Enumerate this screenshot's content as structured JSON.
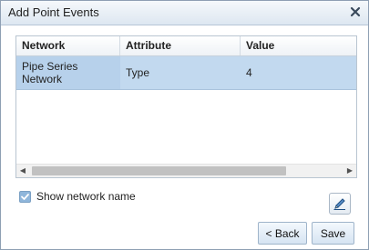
{
  "dialog": {
    "title": "Add Point Events",
    "close_icon": "close-icon"
  },
  "grid": {
    "columns": [
      "Network",
      "Attribute",
      "Value"
    ],
    "rows": [
      {
        "network": "Pipe Series Network",
        "attribute": "Type",
        "value": "4",
        "selected": true
      }
    ],
    "selected_row_color": "#c2d9ef"
  },
  "options": {
    "show_network_name_label": "Show network name",
    "show_network_name_checked": true
  },
  "toolbar": {
    "edit_icon": "pencil-icon"
  },
  "footer": {
    "back_label": "< Back",
    "save_label": "Save"
  }
}
